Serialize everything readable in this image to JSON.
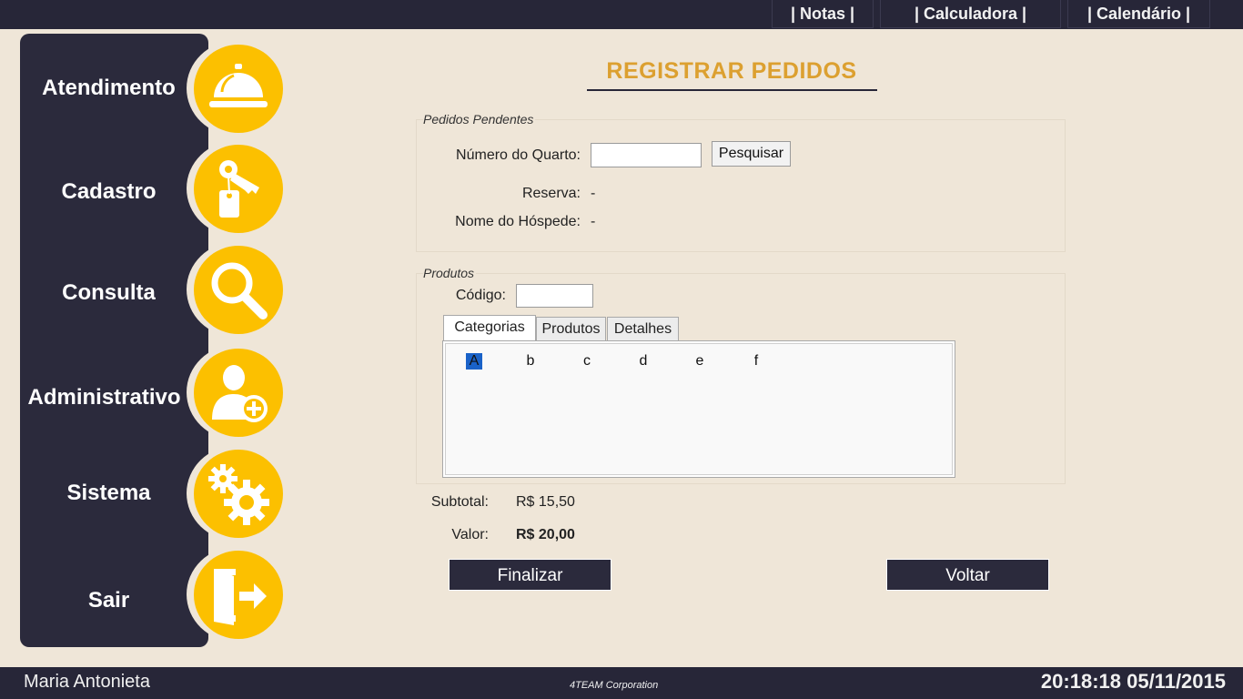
{
  "topnav": {
    "notes": "| Notas |",
    "calculator": "| Calculadora |",
    "calendar": "| Calendário |"
  },
  "sidebar": {
    "items": [
      {
        "label": "Atendimento",
        "icon": "service-bell-icon"
      },
      {
        "label": "Cadastro",
        "icon": "key-tag-icon"
      },
      {
        "label": "Consulta",
        "icon": "magnifier-icon"
      },
      {
        "label": "Administrativo",
        "icon": "add-user-icon"
      },
      {
        "label": "Sistema",
        "icon": "gears-icon"
      },
      {
        "label": "Sair",
        "icon": "exit-door-icon"
      }
    ]
  },
  "page": {
    "title": "REGISTRAR PEDIDOS"
  },
  "pending": {
    "legend": "Pedidos Pendentes",
    "room_label": "Número do Quarto:",
    "room_value": "",
    "search_button": "Pesquisar",
    "reservation_label": "Reserva:",
    "reservation_value": "-",
    "guest_label": "Nome do Hóspede:",
    "guest_value": "-"
  },
  "products": {
    "legend": "Produtos",
    "code_label": "Código:",
    "code_value": "",
    "tabs": [
      "Categorias",
      "Produtos",
      "Detalhes"
    ],
    "active_tab": "Categorias",
    "categories": [
      "A",
      "b",
      "c",
      "d",
      "e",
      "f"
    ],
    "selected_category": "A"
  },
  "totals": {
    "subtotal_label": "Subtotal:",
    "subtotal_value": "R$ 15,50",
    "value_label": "Valor:",
    "value_value": "R$ 20,00"
  },
  "actions": {
    "finish": "Finalizar",
    "back": "Voltar"
  },
  "footer": {
    "user": "Maria Antonieta",
    "company": "4TEAM Corporation",
    "datetime": "20:18:18 05/11/2015"
  },
  "colors": {
    "accent": "#fcc000",
    "dark": "#272638",
    "background": "#efe6d8",
    "title": "#dca030"
  }
}
